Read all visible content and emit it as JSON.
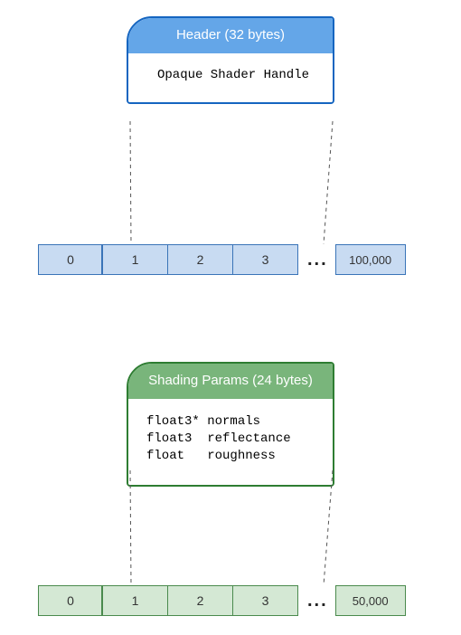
{
  "top": {
    "callout_title": "Header (32 bytes)",
    "callout_body": "Opaque Shader Handle",
    "cells": [
      "0",
      "1",
      "2",
      "3"
    ],
    "dots": "...",
    "last": "100,000",
    "theme": {
      "border": "#1565c0",
      "fill_header": "#64a6e8",
      "cell_fill": "#c8dbf2",
      "cell_border": "#3a74b8"
    }
  },
  "bottom": {
    "callout_title": "Shading Params (24 bytes)",
    "callout_body": "float3* normals\nfloat3  reflectance\nfloat   roughness",
    "cells": [
      "0",
      "1",
      "2",
      "3"
    ],
    "dots": "...",
    "last": "50,000",
    "theme": {
      "border": "#2e7d32",
      "fill_header": "#79b57b",
      "cell_fill": "#d4e8d4",
      "cell_border": "#4a8a4d"
    }
  }
}
